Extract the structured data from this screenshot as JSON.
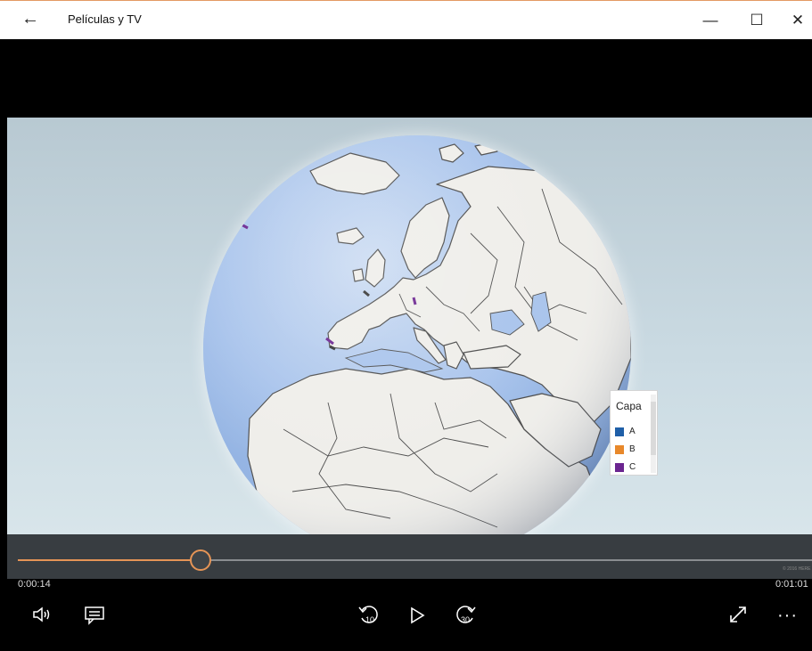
{
  "window": {
    "title": "Películas y TV",
    "back_symbol": "←",
    "minimize_symbol": "—",
    "maximize_symbol": "☐",
    "close_symbol": "✕"
  },
  "legend": {
    "title": "Capa",
    "items": [
      {
        "label": "A",
        "color": "#1f5fa8"
      },
      {
        "label": "B",
        "color": "#e8882a"
      },
      {
        "label": "C",
        "color": "#6b2590"
      }
    ]
  },
  "player": {
    "current_time": "0:00:14",
    "total_time": "0:01:01",
    "progress": 0.232,
    "accent": "#e59456",
    "attribution": "© 2016 HERE",
    "icons": {
      "volume": "volume-icon",
      "captions": "captions-icon",
      "rewind": "rewind-10-icon",
      "play": "play-icon",
      "forward": "forward-30-icon",
      "fullscreen": "fullscreen-icon",
      "more": "more-icon"
    },
    "rewind_label": "10",
    "forward_label": "30",
    "more_symbol": "···"
  }
}
